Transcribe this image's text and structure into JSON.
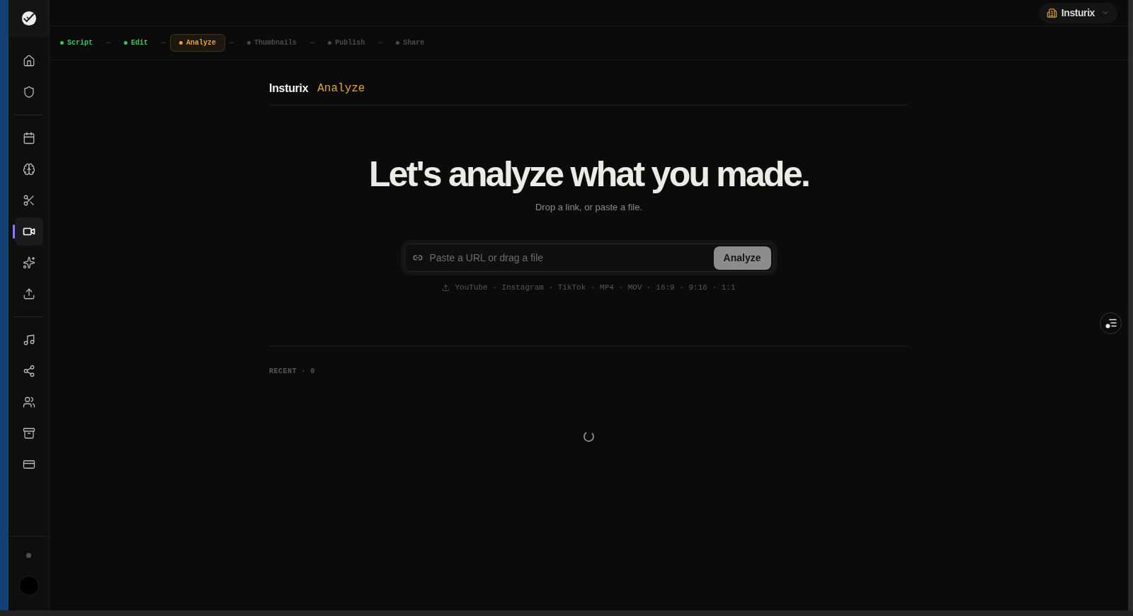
{
  "sidebar": {
    "groups": [
      {
        "items": [
          {
            "selected": false
          },
          {
            "selected": false
          }
        ]
      },
      {
        "items": [
          {
            "selected": false
          },
          {
            "selected": false
          },
          {
            "selected": false
          },
          {
            "selected": true
          },
          {
            "selected": false
          },
          {
            "selected": false
          }
        ]
      },
      {
        "items": [
          {
            "selected": false
          },
          {
            "selected": false
          },
          {
            "selected": false
          },
          {
            "selected": false
          },
          {
            "selected": false
          }
        ]
      }
    ]
  },
  "workspace": {
    "name": "Insturix"
  },
  "steps": [
    {
      "label": "Script",
      "done": true,
      "selected": false
    },
    {
      "label": "Edit",
      "done": true,
      "selected": false
    },
    {
      "label": "Analyze",
      "done": false,
      "selected": true
    },
    {
      "label": "Thumbnails",
      "done": false,
      "selected": false
    },
    {
      "label": "Publish",
      "done": false,
      "selected": false
    },
    {
      "label": "Share",
      "done": false,
      "selected": false
    }
  ],
  "step_separators": [
    "—",
    "—",
    "—",
    "—",
    "—"
  ],
  "page_header": {
    "brand": "Insturix",
    "title": "Analyze"
  },
  "hero": {
    "title": "Let's analyze what you made.",
    "subtitle": "Drop a link, or paste a file."
  },
  "url_bar": {
    "placeholder": "Paste a URL or drag a file",
    "button": {
      "label": "Analyze",
      "disabled": true
    }
  },
  "formats": "YouTube · Instagram · TikTok · MP4 · MOV · 16:9 · 9:16 · 1:1",
  "recent": {
    "label": "RECENT · 0",
    "loading": true
  }
}
